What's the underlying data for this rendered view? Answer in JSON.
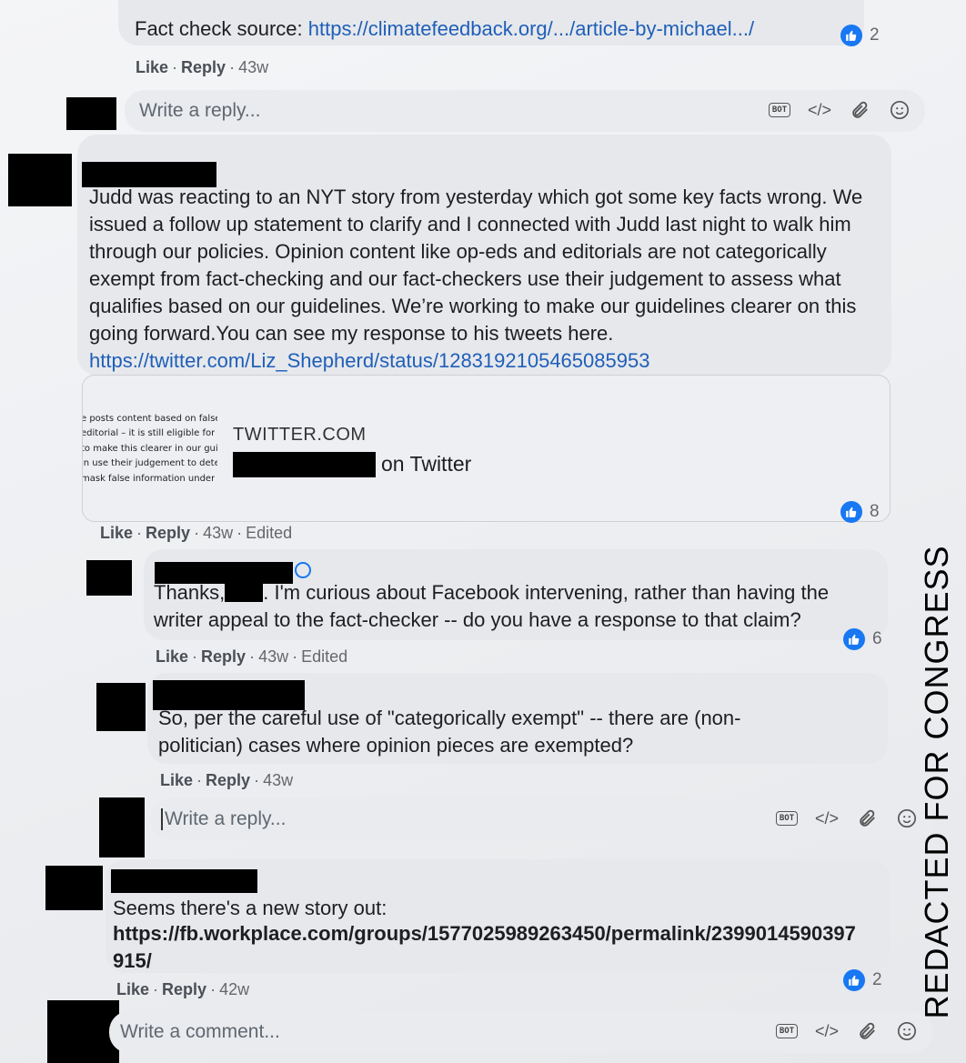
{
  "comments": [
    {
      "text_prefix": "Fact check source: ",
      "link": "https://climatefeedback.org/.../article-by-michael.../",
      "likes": "2",
      "actions": {
        "like": "Like",
        "reply": "Reply",
        "time": "43w"
      }
    },
    {
      "text": "Judd was reacting to an NYT story from yesterday which got some key facts wrong. We issued a follow up statement to clarify and I connected with Judd last night to walk him through our policies. Opinion content like op-eds and editorials are not categorically exempt from fact-checking and our fact-checkers use their judgement to assess what qualifies based on our guidelines. We’re working to make our guidelines clearer on this going forward.You can see my response to his tweets here. ",
      "link": "https://twitter.com/Liz_Shepherd/status/1283192105465085953",
      "preview": {
        "domain": "TWITTER.COM",
        "title_suffix": "on Twitter",
        "thumb_lines": [
          "e posts content based on false",
          "editorial – it is still eligible for",
          "to make this clearer in our guic",
          "in use their judgement to dete",
          "mask false information under"
        ]
      },
      "likes": "8",
      "actions": {
        "like": "Like",
        "reply": "Reply",
        "time": "43w",
        "edited": "Edited"
      }
    },
    {
      "text_a": "Thanks,",
      "text_b": ". I'm curious about Facebook intervening, rather than having the writer appeal to the fact-checker -- do you have a response to that claim?",
      "likes": "6",
      "actions": {
        "like": "Like",
        "reply": "Reply",
        "time": "43w",
        "edited": "Edited"
      }
    },
    {
      "text": "So, per the careful use of \"categorically exempt\" -- there are (non-politician) cases where opinion pieces are exempted?",
      "actions": {
        "like": "Like",
        "reply": "Reply",
        "time": "43w"
      }
    },
    {
      "text": "Seems there's a new story out:",
      "link": "https://fb.workplace.com/groups/1577025989263450/permalink/2399014590397915/",
      "likes": "2",
      "actions": {
        "like": "Like",
        "reply": "Reply",
        "time": "42w"
      }
    }
  ],
  "composers": {
    "reply_placeholder": "Write a reply...",
    "comment_placeholder": "Write a comment...",
    "bot_label": "BOT",
    "code_label": "</>"
  },
  "watermark": "REDACTED FOR CONGRESS",
  "colors": {
    "link": "#1f5fb8",
    "like_badge": "#1877f2",
    "bubble": "#e6e8ec"
  }
}
